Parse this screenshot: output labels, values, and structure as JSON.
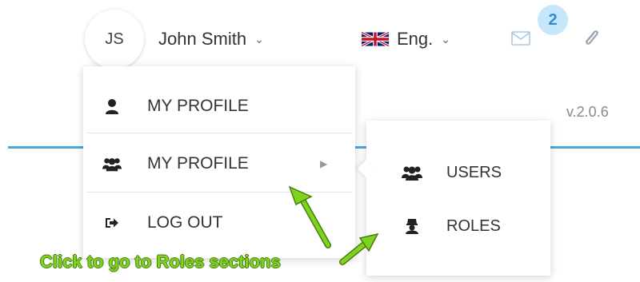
{
  "header": {
    "avatar_initials": "JS",
    "user_name": "John Smith",
    "language": "Eng.",
    "notification_count": "2",
    "version": "v.2.0.6",
    "accent_color": "#4aa8df"
  },
  "user_menu": {
    "items": [
      {
        "label": "MY PROFILE",
        "icon": "user-icon"
      },
      {
        "label": "MY PROFILE",
        "icon": "users-group-icon",
        "has_submenu": true
      },
      {
        "label": "LOG OUT",
        "icon": "logout-icon"
      }
    ]
  },
  "submenu": {
    "items": [
      {
        "label": "USERS",
        "icon": "users-group-icon"
      },
      {
        "label": "ROLES",
        "icon": "role-icon"
      }
    ]
  },
  "annotation": {
    "text": "Click to go to Roles sections",
    "color": "#7ed321"
  }
}
